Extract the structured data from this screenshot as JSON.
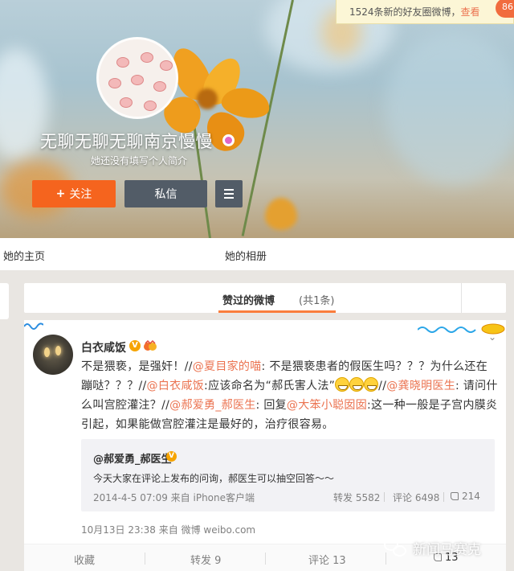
{
  "notification": {
    "text": "1524条新的好友圈微博，",
    "link": "查看",
    "badge": "86"
  },
  "profile": {
    "nickname": "无聊无聊无聊南京慢慢",
    "bio": "她还没有填写个人简介",
    "follow_label": "关注",
    "follow_icon": "+",
    "message_label": "私信",
    "menu_icon": "hamburger-icon"
  },
  "tabs": [
    {
      "label": "她的主页"
    },
    {
      "label": "她的相册"
    }
  ],
  "section": {
    "title": "赞过的微博",
    "count": "(共1条)"
  },
  "post": {
    "author": "白衣咸饭",
    "verified_badge": "V",
    "text_parts": [
      {
        "t": "不是猥亵，是强奸！//",
        "at": false
      },
      {
        "t": "@夏目家的喵",
        "at": true
      },
      {
        "t": ": 不是猥亵患者的假医生吗？？？为什么还在蹦哒？？？//",
        "at": false
      },
      {
        "t": "@白衣咸饭",
        "at": true
      },
      {
        "t": ":应该命名为“郝氏害人法”",
        "at": false
      },
      {
        "t": "//",
        "at": false
      },
      {
        "t": "@龚晓明医生",
        "at": true
      },
      {
        "t": ": 请问什么叫宫腔灌注？//",
        "at": false
      },
      {
        "t": "@郝爱勇_郝医生",
        "at": true
      },
      {
        "t": ": 回复",
        "at": false
      },
      {
        "t": "@大笨小聪囡囡",
        "at": true
      },
      {
        "t": ":这一种一般是子宫内膜炎引起，如果能做宫腔灌注是最好的，治疗很容易。",
        "at": false
      }
    ],
    "quoted": {
      "author": "@郝爱勇_郝医生",
      "verified_badge": "V",
      "text": "今天大家在评论上发布的问询，郝医生可以抽空回答～～",
      "meta": "2014-4-5 07:09 来自 iPhone客户端",
      "repost": "转发 5582",
      "comment": "评论 6498",
      "like": "214"
    },
    "meta": "10月13日 23:38 来自 微博 weibo.com",
    "actions": {
      "collect": "收藏",
      "repost": "转发 9",
      "comment": "评论 13",
      "like": "13"
    },
    "more_icon": "chevron-down-icon"
  },
  "watermark": "新闻马赛克",
  "colors": {
    "accent": "#f5641e",
    "link": "#eb7350",
    "dark_button": "#525c67"
  }
}
